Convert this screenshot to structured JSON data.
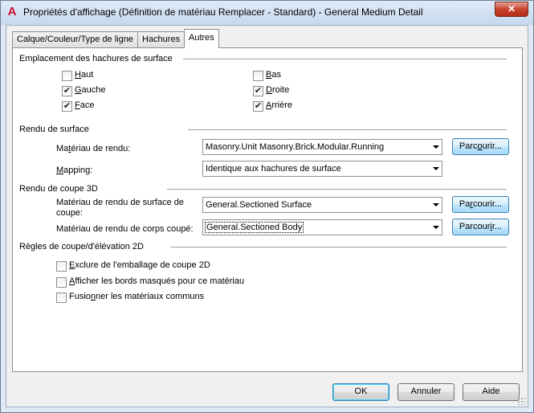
{
  "window": {
    "title": "Propriétés d'affichage (Définition de matériau Remplacer - Standard) - General Medium Detail",
    "app_icon": "A",
    "close_glyph": "✕"
  },
  "tabs": [
    {
      "label": "Calque/Couleur/Type de ligne",
      "active": false
    },
    {
      "label": "Hachures",
      "active": false
    },
    {
      "label": "Autres",
      "active": true
    }
  ],
  "surface_hatch": {
    "title": "Emplacement des hachures de surface",
    "items": [
      {
        "pre": "",
        "ul": "H",
        "post": "aut",
        "checked": false
      },
      {
        "pre": "",
        "ul": "B",
        "post": "as",
        "checked": false
      },
      {
        "pre": "",
        "ul": "G",
        "post": "auche",
        "checked": true
      },
      {
        "pre": "",
        "ul": "D",
        "post": "roite",
        "checked": true
      },
      {
        "pre": "",
        "ul": "F",
        "post": "ace",
        "checked": true
      },
      {
        "pre": "",
        "ul": "A",
        "post": "rrière",
        "checked": true
      }
    ]
  },
  "surface_render": {
    "title": "Rendu de surface",
    "material_label": {
      "pre": "Ma",
      "ul": "t",
      "post": "ériau de rendu:"
    },
    "material_value": "Masonry.Unit Masonry.Brick.Modular.Running",
    "mapping_label": {
      "pre": "",
      "ul": "M",
      "post": "apping:"
    },
    "mapping_value": "Identique aux hachures de surface",
    "browse": {
      "pre": "Parc",
      "ul": "o",
      "post": "urir..."
    }
  },
  "section_render": {
    "title": "Rendu de coupe 3D",
    "surface_label_1": "Matériau de rendu de surface de",
    "surface_label_2": "coupe:",
    "surface_value": "General.Sectioned Surface",
    "body_label": "Matériau de rendu de corps coupé:",
    "body_value": "General.Sectioned Body",
    "browse1": {
      "pre": "Pa",
      "ul": "r",
      "post": "courir..."
    },
    "browse2": {
      "pre": "Parcour",
      "ul": "i",
      "post": "r..."
    }
  },
  "rules_2d": {
    "title": "Règles de coupe/d'élévation 2D",
    "items": [
      {
        "pre": "",
        "ul": "E",
        "post": "xclure de l'emballage de coupe 2D",
        "checked": false
      },
      {
        "pre": "",
        "ul": "A",
        "post": "fficher les bords masqués pour ce matériau",
        "checked": false
      },
      {
        "pre": "Fusio",
        "ul": "n",
        "post": "ner les matériaux communs",
        "checked": false
      }
    ]
  },
  "footer": {
    "ok": "OK",
    "cancel": "Annuler",
    "help": "Aide"
  },
  "check_glyph": "✔"
}
